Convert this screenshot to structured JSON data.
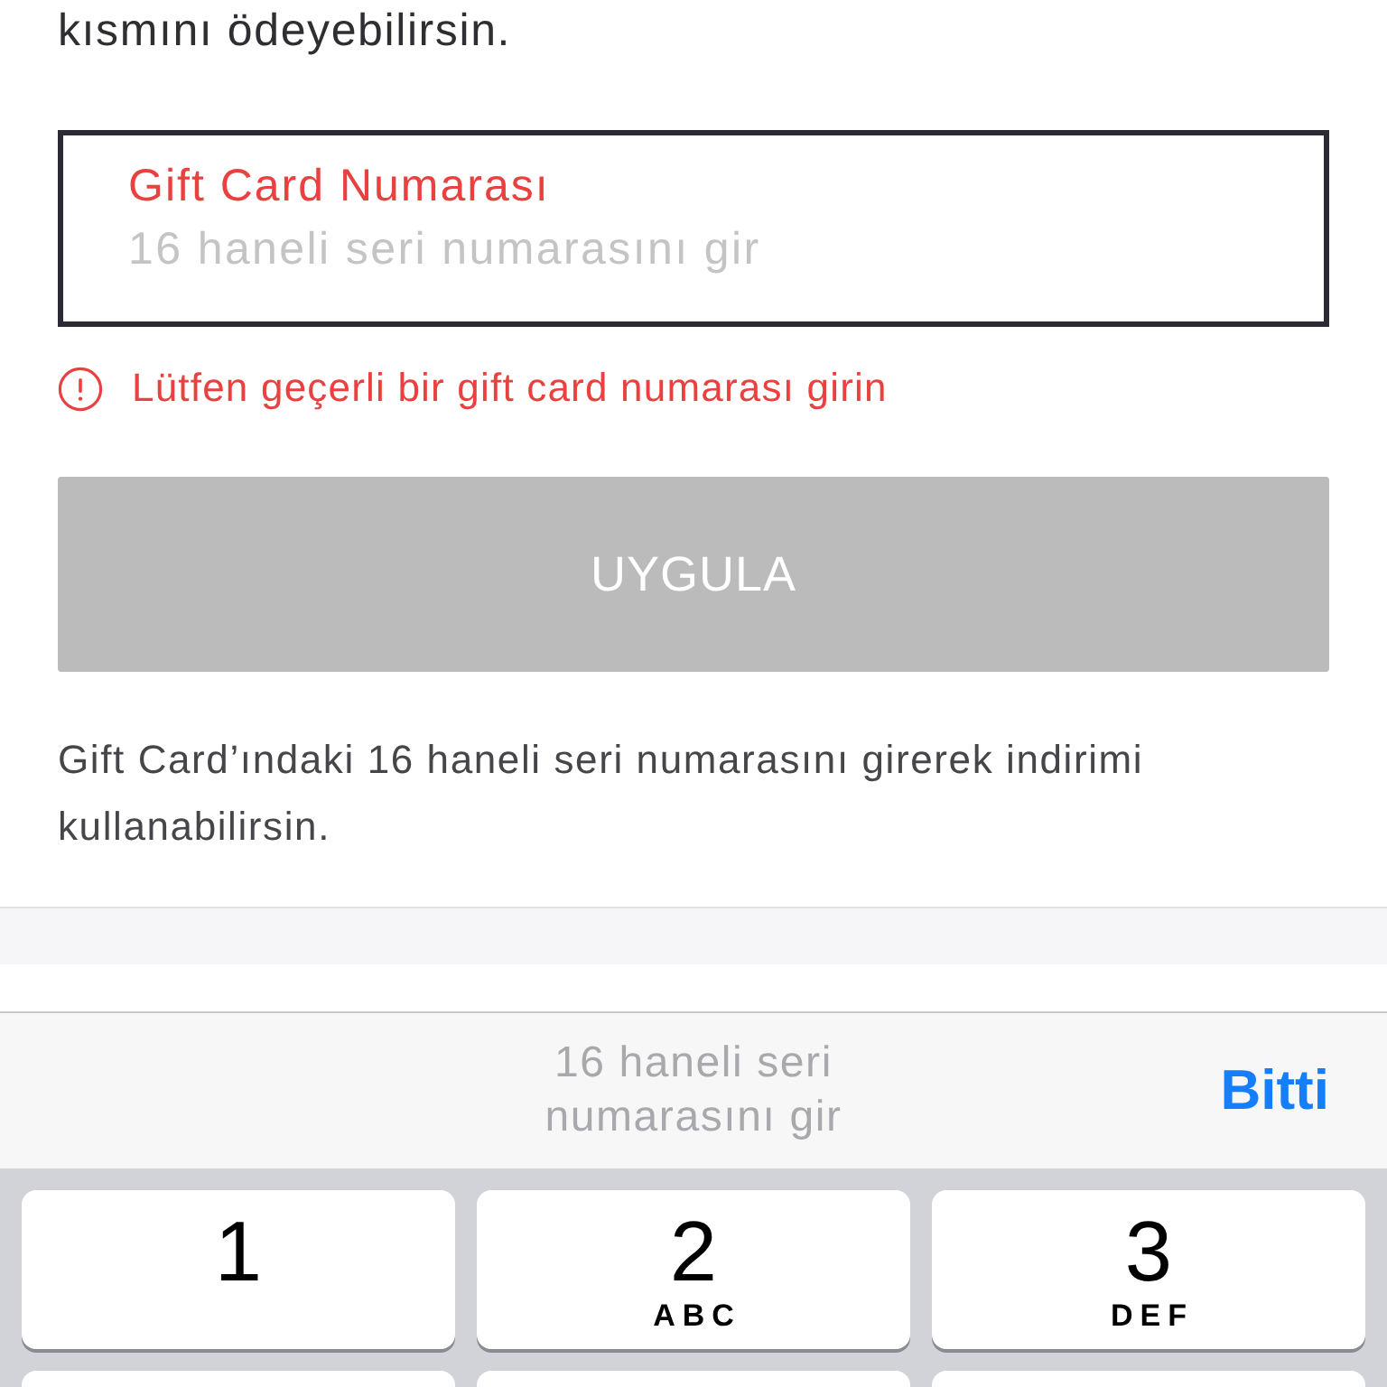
{
  "intro": {
    "text": "kısmını ödeyebilirsin."
  },
  "gift_card_field": {
    "label": "Gift Card Numarası",
    "placeholder": "16 haneli seri numarasını gir",
    "error": true
  },
  "error_message": {
    "text": "Lütfen geçerli bir gift card numarası girin"
  },
  "apply_button": {
    "label": "UYGULA",
    "disabled": true
  },
  "help_text": {
    "text": "Gift Card’ındaki 16 haneli seri numarasını girerek indirimi kullanabilirsin."
  },
  "keyboard_toolbar": {
    "prompt": "16 haneli seri numarasını gir",
    "done": "Bitti"
  },
  "keypad": {
    "keys": [
      {
        "digit": "1"
      },
      {
        "digit": "2",
        "letters": "ABC"
      },
      {
        "digit": "3",
        "letters": "DEF"
      }
    ]
  }
}
